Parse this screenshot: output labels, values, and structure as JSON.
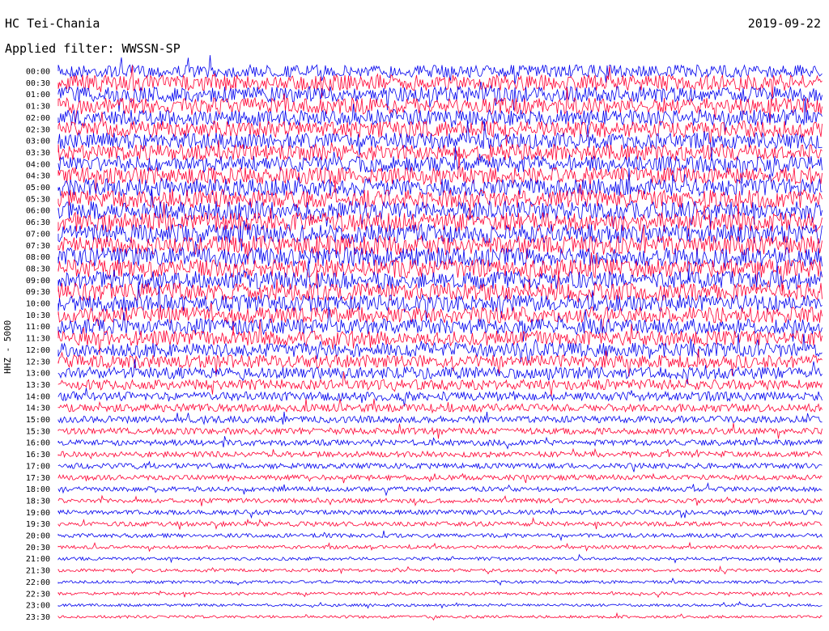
{
  "header": {
    "station": "HC Tei-Chania",
    "filter": "Applied filter: WWSSN-SP",
    "date": "2019-09-22",
    "channel": "HHZ - 5000"
  },
  "colors": {
    "series_a": "#0000ee",
    "series_b": "#ff0033"
  },
  "chart_data": {
    "type": "line",
    "title": "HC Tei-Chania",
    "subtitle": "Applied filter: WWSSN-SP",
    "date": "2019-09-22",
    "ylabel": "HHZ - 5000",
    "xlabel": "",
    "grid": false,
    "legend": "none",
    "row_interval_minutes": 30,
    "rows": [
      {
        "label": "00:00",
        "amplitude": 0.55
      },
      {
        "label": "00:30",
        "amplitude": 0.7
      },
      {
        "label": "01:00",
        "amplitude": 0.7
      },
      {
        "label": "01:30",
        "amplitude": 0.72
      },
      {
        "label": "02:00",
        "amplitude": 0.72
      },
      {
        "label": "02:30",
        "amplitude": 0.72
      },
      {
        "label": "03:00",
        "amplitude": 0.72
      },
      {
        "label": "03:30",
        "amplitude": 0.72
      },
      {
        "label": "04:00",
        "amplitude": 0.72
      },
      {
        "label": "04:30",
        "amplitude": 0.75
      },
      {
        "label": "05:00",
        "amplitude": 0.78
      },
      {
        "label": "05:30",
        "amplitude": 0.8
      },
      {
        "label": "06:00",
        "amplitude": 0.82
      },
      {
        "label": "06:30",
        "amplitude": 0.85
      },
      {
        "label": "07:00",
        "amplitude": 0.85
      },
      {
        "label": "07:30",
        "amplitude": 0.85
      },
      {
        "label": "08:00",
        "amplitude": 0.85
      },
      {
        "label": "08:30",
        "amplitude": 0.82
      },
      {
        "label": "09:00",
        "amplitude": 0.8
      },
      {
        "label": "09:30",
        "amplitude": 0.78
      },
      {
        "label": "10:00",
        "amplitude": 0.75
      },
      {
        "label": "10:30",
        "amplitude": 0.72
      },
      {
        "label": "11:00",
        "amplitude": 0.7
      },
      {
        "label": "11:30",
        "amplitude": 0.68
      },
      {
        "label": "12:00",
        "amplitude": 0.62
      },
      {
        "label": "12:30",
        "amplitude": 0.58
      },
      {
        "label": "13:00",
        "amplitude": 0.52
      },
      {
        "label": "13:30",
        "amplitude": 0.46
      },
      {
        "label": "14:00",
        "amplitude": 0.4
      },
      {
        "label": "14:30",
        "amplitude": 0.35
      },
      {
        "label": "15:00",
        "amplitude": 0.3
      },
      {
        "label": "15:30",
        "amplitude": 0.28
      },
      {
        "label": "16:00",
        "amplitude": 0.26
      },
      {
        "label": "16:30",
        "amplitude": 0.25
      },
      {
        "label": "17:00",
        "amplitude": 0.24
      },
      {
        "label": "17:30",
        "amplitude": 0.22
      },
      {
        "label": "18:00",
        "amplitude": 0.21
      },
      {
        "label": "18:30",
        "amplitude": 0.2
      },
      {
        "label": "19:00",
        "amplitude": 0.2
      },
      {
        "label": "19:30",
        "amplitude": 0.2
      },
      {
        "label": "20:00",
        "amplitude": 0.18
      },
      {
        "label": "20:30",
        "amplitude": 0.15
      },
      {
        "label": "21:00",
        "amplitude": 0.14
      },
      {
        "label": "21:30",
        "amplitude": 0.14
      },
      {
        "label": "22:00",
        "amplitude": 0.13
      },
      {
        "label": "22:30",
        "amplitude": 0.13
      },
      {
        "label": "23:00",
        "amplitude": 0.12
      },
      {
        "label": "23:30",
        "amplitude": 0.12
      }
    ]
  }
}
